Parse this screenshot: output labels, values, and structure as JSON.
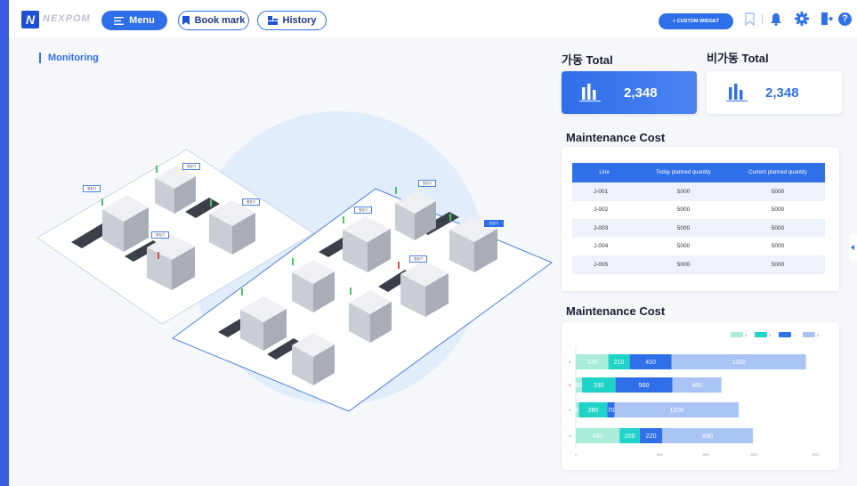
{
  "header": {
    "logo_letter": "N",
    "brand": "NEXPOM",
    "menu_label": "Menu",
    "bookmark_label": "Book mark",
    "history_label": "History",
    "custom_widget_label": "+ CUSTOM WIDGET",
    "accent_color": "#2f6fe8",
    "icons": [
      "bookmark-outline-icon",
      "bell-icon",
      "gear-icon",
      "logout-icon",
      "help-icon"
    ],
    "help_glyph": "?"
  },
  "monitoring": {
    "title": "Monitoring",
    "machine_tag": "명칭기"
  },
  "kpi": {
    "running_label": "가동 Total",
    "running_value": "2,348",
    "idle_label": "비가동 Total",
    "idle_value": "2,348"
  },
  "maintenance_table": {
    "title": "Maintenance Cost",
    "columns": [
      "Line",
      "Today planned quantity",
      "Current planned quantity"
    ],
    "rows": [
      [
        "J-001",
        "5000",
        "5000"
      ],
      [
        "J-002",
        "5000",
        "5000"
      ],
      [
        "J-003",
        "5000",
        "5000"
      ],
      [
        "J-004",
        "5000",
        "5000"
      ],
      [
        "J-005",
        "5000",
        "5000"
      ]
    ]
  },
  "maintenance_chart": {
    "title": "Maintenance Cost"
  },
  "chart_data": {
    "type": "bar",
    "orientation": "horizontal",
    "stacked": true,
    "title": "Maintenance Cost",
    "categories": [
      "A",
      "B",
      "C",
      "D"
    ],
    "series": [
      {
        "name": "A",
        "color": "#a8ecd9",
        "values": [
          320,
          60,
          30,
          430
        ]
      },
      {
        "name": "B",
        "color": "#1fd3c6",
        "values": [
          210,
          330,
          280,
          200
        ]
      },
      {
        "name": "C",
        "color": "#2f6fe8",
        "values": [
          410,
          560,
          70,
          220
        ]
      },
      {
        "name": "D",
        "color": "#a9c3f4",
        "values": [
          1320,
          480,
          1220,
          890
        ]
      }
    ],
    "xlim": [
      0,
      2500
    ],
    "xticks": [
      "0",
      "1000",
      "1500",
      "2000",
      "2500"
    ],
    "legend_position": "top-right",
    "grid": false
  }
}
